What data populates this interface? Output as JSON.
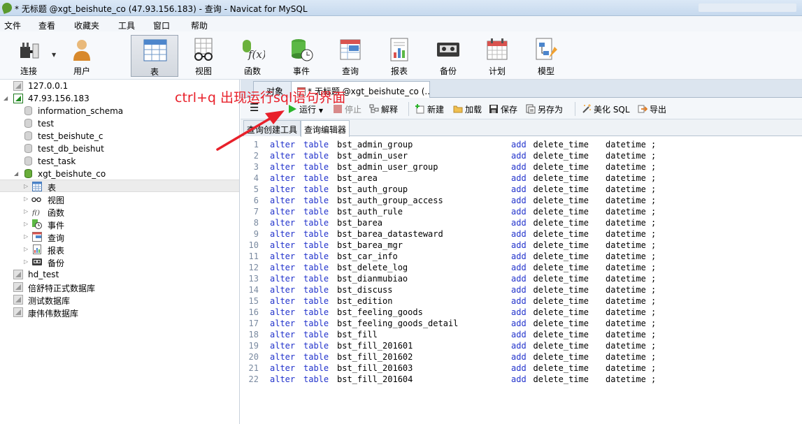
{
  "window": {
    "title": "* 无标题 @xgt_beishute_co (47.93.156.183) - 查询 - Navicat for MySQL"
  },
  "menu": [
    "文件",
    "查看",
    "收藏夹",
    "工具",
    "窗口",
    "帮助"
  ],
  "toolbar": {
    "connect": "连接",
    "user": "用户",
    "table": "表",
    "view": "视图",
    "function": "函数",
    "event": "事件",
    "query": "查询",
    "report": "报表",
    "backup": "备份",
    "schedule": "计划",
    "model": "模型"
  },
  "tree": {
    "items": [
      {
        "label": "127.0.0.1"
      },
      {
        "label": "47.93.156.183"
      },
      {
        "label": "information_schema"
      },
      {
        "label": "test"
      },
      {
        "label": "test_beishute_c"
      },
      {
        "label": "test_db_beishut"
      },
      {
        "label": "test_task"
      },
      {
        "label": "xgt_beishute_co"
      },
      {
        "label": "表"
      },
      {
        "label": "视图"
      },
      {
        "label": "函数"
      },
      {
        "label": "事件"
      },
      {
        "label": "查询"
      },
      {
        "label": "报表"
      },
      {
        "label": "备份"
      },
      {
        "label": "hd_test"
      },
      {
        "label": "倍舒特正式数据库"
      },
      {
        "label": "测试数据库"
      },
      {
        "label": "康伟伟数据库"
      }
    ]
  },
  "tabs": {
    "objects": "对象",
    "query": "* 无标题 @xgt_beishute_co (..."
  },
  "query_toolbar": {
    "run": "运行",
    "stop": "停止",
    "explain": "解释",
    "new": "新建",
    "load": "加载",
    "save": "保存",
    "save_as": "另存为",
    "beautify": "美化 SQL",
    "export": "导出"
  },
  "subtabs": {
    "builder": "查询创建工具",
    "editor": "查询编辑器"
  },
  "annotation": "ctrl+q  出现运行sql语句界面",
  "sql": {
    "kw_alter": "alter",
    "kw_table": "table",
    "kw_add": "add",
    "column": "delete_time",
    "type": "datetime ;",
    "lines": [
      {
        "num": "1",
        "table": "bst_admin_group"
      },
      {
        "num": "2",
        "table": "bst_admin_user"
      },
      {
        "num": "3",
        "table": "bst_admin_user_group"
      },
      {
        "num": "4",
        "table": "bst_area"
      },
      {
        "num": "5",
        "table": "bst_auth_group"
      },
      {
        "num": "6",
        "table": "bst_auth_group_access"
      },
      {
        "num": "7",
        "table": "bst_auth_rule"
      },
      {
        "num": "8",
        "table": "bst_barea"
      },
      {
        "num": "9",
        "table": "bst_barea_datasteward"
      },
      {
        "num": "10",
        "table": "bst_barea_mgr"
      },
      {
        "num": "11",
        "table": "bst_car_info"
      },
      {
        "num": "12",
        "table": "bst_delete_log"
      },
      {
        "num": "13",
        "table": "bst_dianmubiao"
      },
      {
        "num": "14",
        "table": "bst_discuss"
      },
      {
        "num": "15",
        "table": "bst_edition"
      },
      {
        "num": "16",
        "table": "bst_feeling_goods"
      },
      {
        "num": "17",
        "table": "bst_feeling_goods_detail"
      },
      {
        "num": "18",
        "table": "bst_fill"
      },
      {
        "num": "19",
        "table": "bst_fill_201601"
      },
      {
        "num": "20",
        "table": "bst_fill_201602"
      },
      {
        "num": "21",
        "table": "bst_fill_201603"
      },
      {
        "num": "22",
        "table": "bst_fill_201604"
      }
    ]
  }
}
